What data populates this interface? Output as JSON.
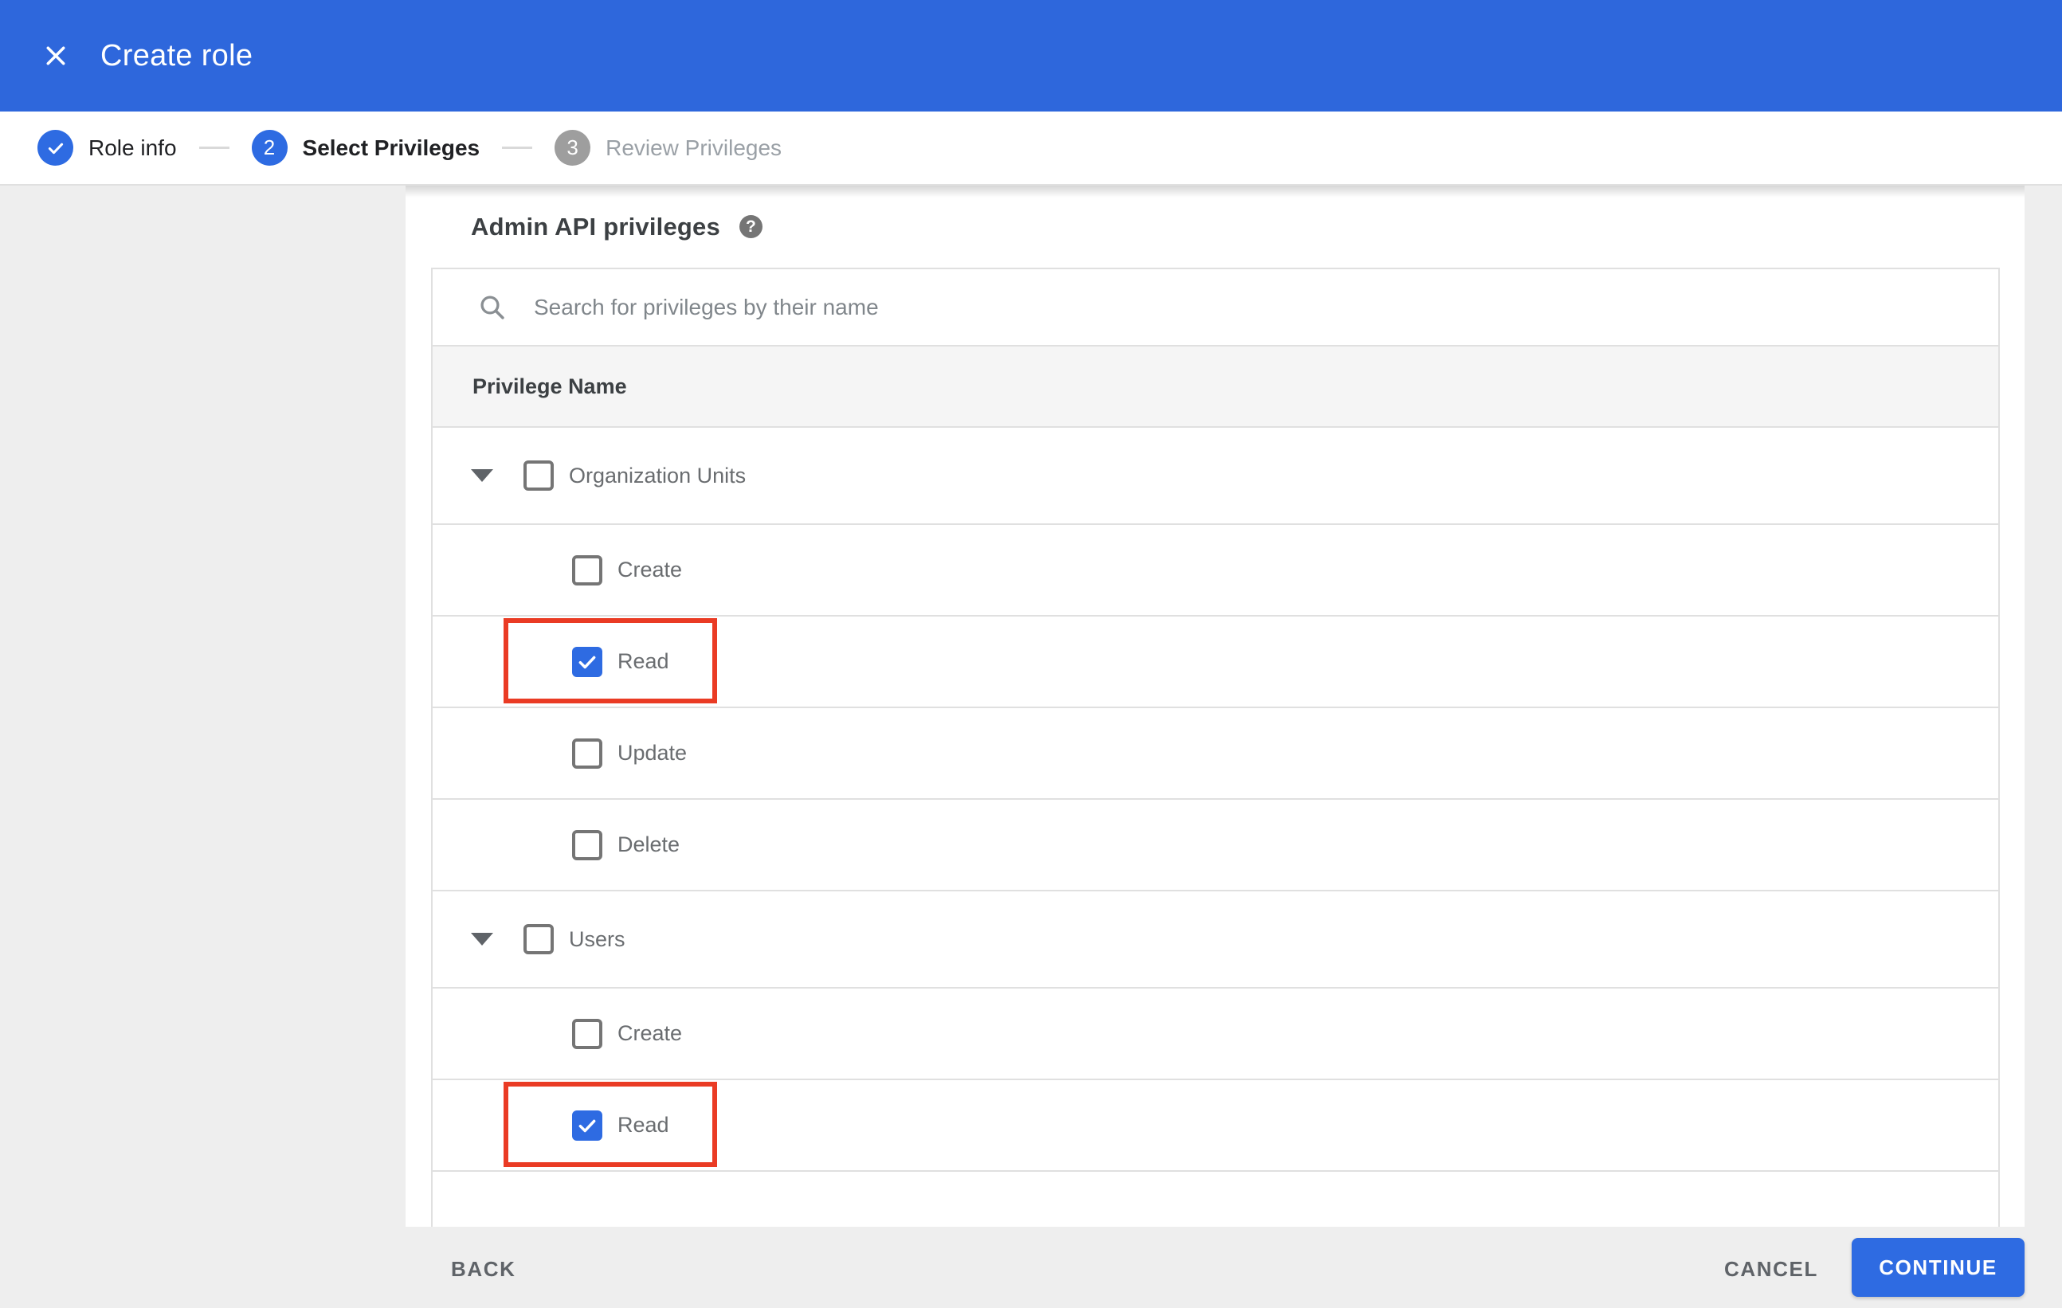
{
  "colors": {
    "header_blue": "#2e67dc",
    "accent_blue": "#2e6be2",
    "highlight_red": "#ea3b24",
    "backdrop": "#eeeeee",
    "divider": "#e0e0e0",
    "thead_bg": "#f5f5f5"
  },
  "app_bar": {
    "title": "Create role"
  },
  "stepper": {
    "steps": [
      {
        "state": "done",
        "number": "1",
        "label": "Role info"
      },
      {
        "state": "active",
        "number": "2",
        "label": "Select Privileges"
      },
      {
        "state": "inactive",
        "number": "3",
        "label": "Review Privileges"
      }
    ]
  },
  "content": {
    "heading": "Admin API privileges",
    "search": {
      "placeholder": "Search for privileges by their name"
    },
    "table": {
      "header": "Privilege Name",
      "rows": [
        {
          "type": "parent",
          "label": "Organization Units",
          "checked": false,
          "expanded": true,
          "highlighted": false
        },
        {
          "type": "child",
          "label": "Create",
          "checked": false,
          "highlighted": false
        },
        {
          "type": "child",
          "label": "Read",
          "checked": true,
          "highlighted": true
        },
        {
          "type": "child",
          "label": "Update",
          "checked": false,
          "highlighted": false
        },
        {
          "type": "child",
          "label": "Delete",
          "checked": false,
          "highlighted": false
        },
        {
          "type": "parent",
          "label": "Users",
          "checked": false,
          "expanded": true,
          "highlighted": false
        },
        {
          "type": "child",
          "label": "Create",
          "checked": false,
          "highlighted": false
        },
        {
          "type": "child",
          "label": "Read",
          "checked": true,
          "highlighted": true
        }
      ]
    }
  },
  "footer": {
    "back": "BACK",
    "cancel": "CANCEL",
    "continue": "CONTINUE"
  }
}
